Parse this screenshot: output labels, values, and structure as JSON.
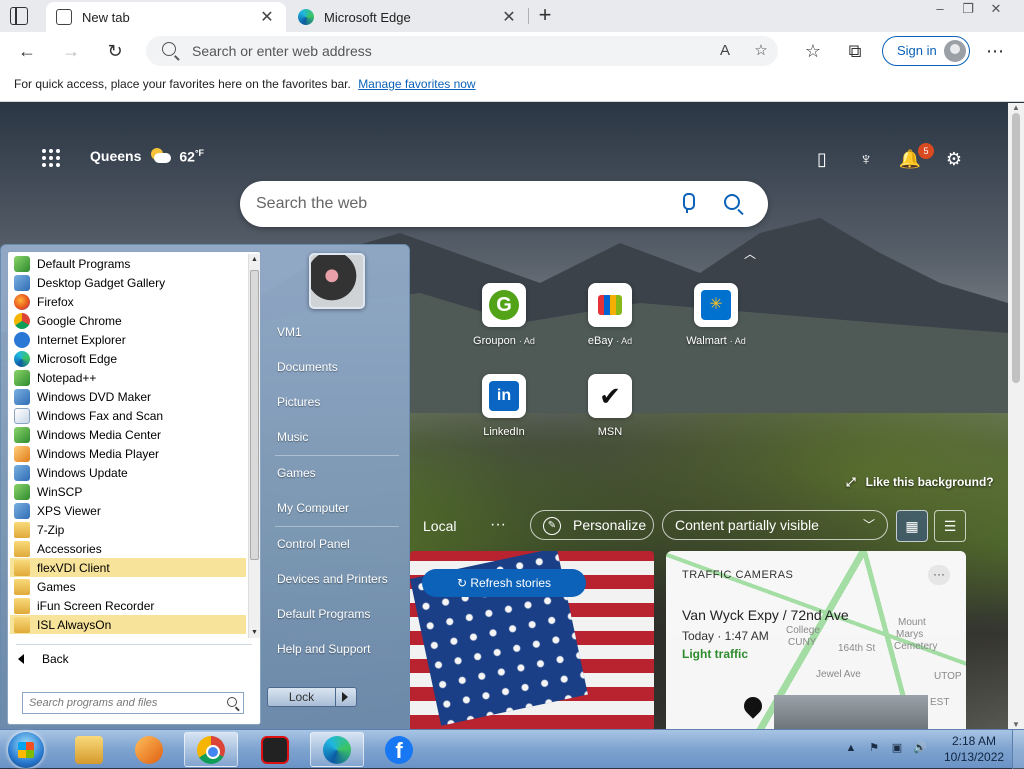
{
  "browser": {
    "tabs": [
      {
        "title": "New tab",
        "icon": "new-tab-page-icon",
        "active": true
      },
      {
        "title": "Microsoft Edge",
        "icon": "edge-icon",
        "active": false
      }
    ],
    "address_placeholder": "Search or enter web address",
    "sign_in_label": "Sign in",
    "favorites_bar": {
      "text": "For quick access, place your favorites here on the favorites bar.",
      "link": "Manage favorites now"
    }
  },
  "ntp": {
    "location": "Queens",
    "temperature": "62",
    "temp_unit": "°F",
    "notifications_count": "5",
    "search_placeholder": "Search the web",
    "tiles": [
      {
        "label": "Groupon",
        "ad": "· Ad",
        "icon": "groupon-icon"
      },
      {
        "label": "eBay",
        "ad": "· Ad",
        "icon": "ebay-icon"
      },
      {
        "label": "Walmart",
        "ad": "· Ad",
        "icon": "walmart-icon"
      },
      {
        "label": "LinkedIn",
        "ad": "",
        "icon": "linkedin-icon"
      },
      {
        "label": "MSN",
        "ad": "",
        "icon": "msn-icon"
      }
    ],
    "like_background": "Like this background?",
    "feed": {
      "local": "Local",
      "personalize": "Personalize",
      "content_visibility": "Content partially visible"
    },
    "refresh_stories": "Refresh stories",
    "traffic": {
      "title": "TRAFFIC CAMERAS",
      "road": "Van Wyck Expy / 72nd Ave",
      "time": "Today · 1:47 AM",
      "status": "Light traffic",
      "map_labels": [
        "College",
        "CUNY",
        "Mount",
        "Marys",
        "Cemetery",
        "UTOP",
        "EST",
        "Jewel Ave",
        "164th St"
      ]
    }
  },
  "start_menu": {
    "programs": [
      {
        "label": "Default Programs",
        "icon": "default-programs-icon",
        "highlight": false
      },
      {
        "label": "Desktop Gadget Gallery",
        "icon": "gadget-gallery-icon",
        "highlight": false
      },
      {
        "label": "Firefox",
        "icon": "firefox-icon",
        "highlight": false
      },
      {
        "label": "Google Chrome",
        "icon": "chrome-icon",
        "highlight": false
      },
      {
        "label": "Internet Explorer",
        "icon": "internet-explorer-icon",
        "highlight": false
      },
      {
        "label": "Microsoft Edge",
        "icon": "edge-icon",
        "highlight": false
      },
      {
        "label": "Notepad++",
        "icon": "notepad-plus-plus-icon",
        "highlight": false
      },
      {
        "label": "Windows DVD Maker",
        "icon": "dvd-maker-icon",
        "highlight": false
      },
      {
        "label": "Windows Fax and Scan",
        "icon": "fax-scan-icon",
        "highlight": false
      },
      {
        "label": "Windows Media Center",
        "icon": "media-center-icon",
        "highlight": false
      },
      {
        "label": "Windows Media Player",
        "icon": "media-player-icon",
        "highlight": false
      },
      {
        "label": "Windows Update",
        "icon": "windows-update-icon",
        "highlight": false
      },
      {
        "label": "WinSCP",
        "icon": "winscp-icon",
        "highlight": false
      },
      {
        "label": "XPS Viewer",
        "icon": "xps-viewer-icon",
        "highlight": false
      },
      {
        "label": "7-Zip",
        "icon": "folder-icon",
        "highlight": false
      },
      {
        "label": "Accessories",
        "icon": "folder-icon",
        "highlight": false
      },
      {
        "label": "flexVDI Client",
        "icon": "folder-icon",
        "highlight": true
      },
      {
        "label": "Games",
        "icon": "folder-icon",
        "highlight": false
      },
      {
        "label": "iFun Screen Recorder",
        "icon": "folder-icon",
        "highlight": false
      },
      {
        "label": "ISL AlwaysOn",
        "icon": "folder-icon",
        "highlight": true
      }
    ],
    "back_label": "Back",
    "search_placeholder": "Search programs and files",
    "right_items": [
      "VM1",
      "Documents",
      "Pictures",
      "Music",
      "Games",
      "My Computer",
      "Control Panel",
      "Devices and Printers",
      "Default Programs",
      "Help and Support"
    ],
    "lock_label": "Lock"
  },
  "taskbar": {
    "apps": [
      {
        "name": "windows-explorer",
        "icon": "folder-icon"
      },
      {
        "name": "windows-media-player",
        "icon": "media-player-icon"
      },
      {
        "name": "google-chrome",
        "icon": "chrome-icon"
      },
      {
        "name": "screen-recorder",
        "icon": "recorder-icon"
      },
      {
        "name": "microsoft-edge",
        "icon": "edge-icon"
      },
      {
        "name": "facebook",
        "icon": "facebook-icon"
      }
    ],
    "time": "2:18 AM",
    "date": "10/13/2022"
  }
}
